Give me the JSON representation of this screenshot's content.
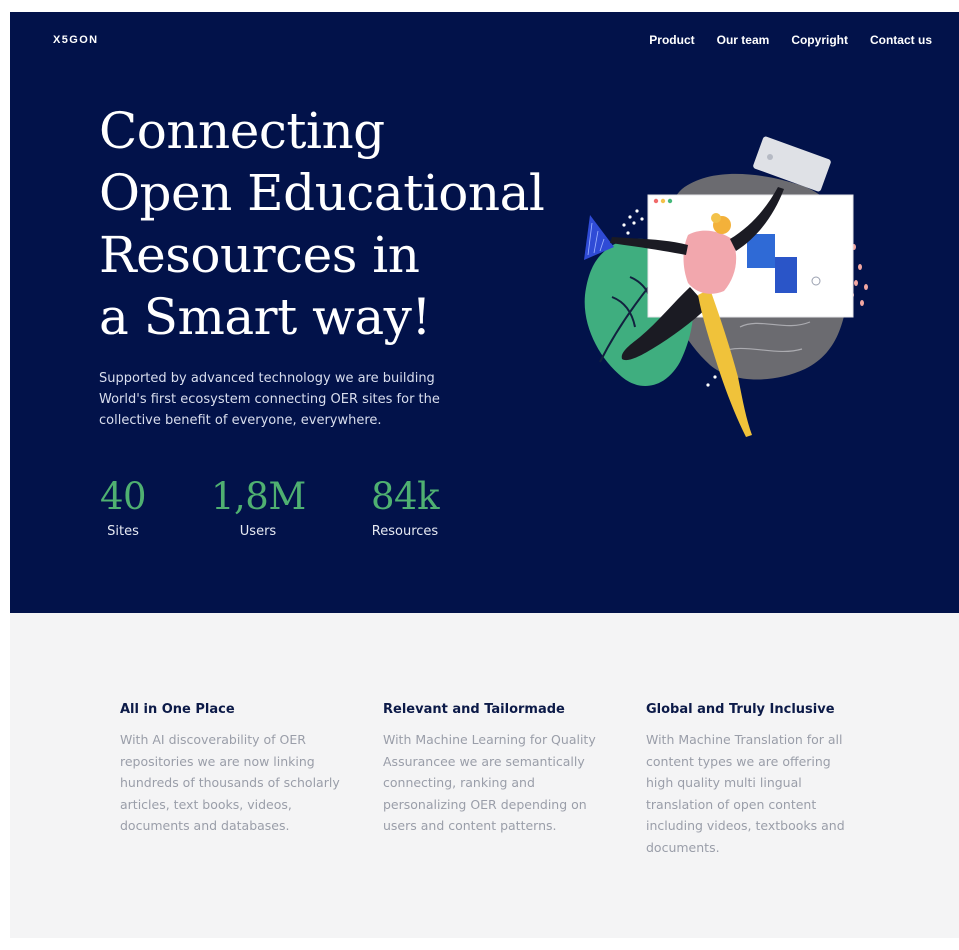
{
  "brand": {
    "logo": "X5GON"
  },
  "nav": {
    "items": [
      {
        "label": "Product"
      },
      {
        "label": "Our team"
      },
      {
        "label": "Copyright"
      },
      {
        "label": "Contact us"
      }
    ]
  },
  "hero": {
    "title_lines": [
      "Connecting",
      "Open Educational",
      "Resources in",
      "a Smart way!"
    ],
    "description": "Supported by advanced technology we are building World's first ecosystem connecting OER sites for the collective benefit of everyone, everywhere.",
    "stats": [
      {
        "value": "40",
        "label": "Sites"
      },
      {
        "value": "1,8M",
        "label": "Users"
      },
      {
        "value": "84k",
        "label": "Resources"
      }
    ]
  },
  "features": [
    {
      "title": "All in One Place",
      "text": "With AI discoverability of OER repositories we are now linking hundreds of thousands of scholarly articles, text books, videos, documents and databases."
    },
    {
      "title": "Relevant and Tailormade",
      "text": "With Machine Learning for Quality Assurancee we are semantically connecting, ranking and personalizing OER depending on users and content patterns."
    },
    {
      "title": "Global and Truly Inclusive",
      "text": "With Machine Translation for all content types we are offering high quality multi lingual translation of open content including videos, textbooks and documents."
    }
  ],
  "colors": {
    "hero_bg": "#02124a",
    "stat_green": "#4fb071",
    "features_bg": "#f4f4f5",
    "heading_dark": "#0c1a48",
    "body_gray": "#9a9ea9"
  },
  "illustration": {
    "name": "person-reaching-browser-illustration"
  }
}
